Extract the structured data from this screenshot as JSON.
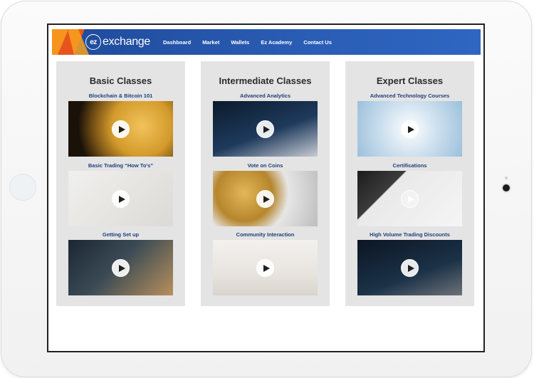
{
  "nav": {
    "logo_badge": "ez",
    "logo_word": "exchange",
    "links": [
      "Dashboard",
      "Market",
      "Wallets",
      "Ez Academy",
      "Contact Us"
    ]
  },
  "cards": [
    {
      "title": "Basic Classes",
      "items": [
        {
          "label": "Blockchain & Bitcoin 101"
        },
        {
          "label": "Basic Trading  “How To’s”"
        },
        {
          "label": "Getting Set up"
        }
      ]
    },
    {
      "title": "Intermediate Classes",
      "items": [
        {
          "label": "Advanced Analytics"
        },
        {
          "label": "Vote on Coins"
        },
        {
          "label": "Community Interaction"
        }
      ]
    },
    {
      "title": "Expert Classes",
      "items": [
        {
          "label": "Advanced Technology Courses"
        },
        {
          "label": "Certifications"
        },
        {
          "label": "High Volume Trading Discounts"
        }
      ]
    }
  ],
  "colors": {
    "nav_blue": "#2a5db5",
    "accent_orange": "#f7941d",
    "label_blue": "#1f3f7a",
    "card_bg": "#e4e4e4"
  }
}
